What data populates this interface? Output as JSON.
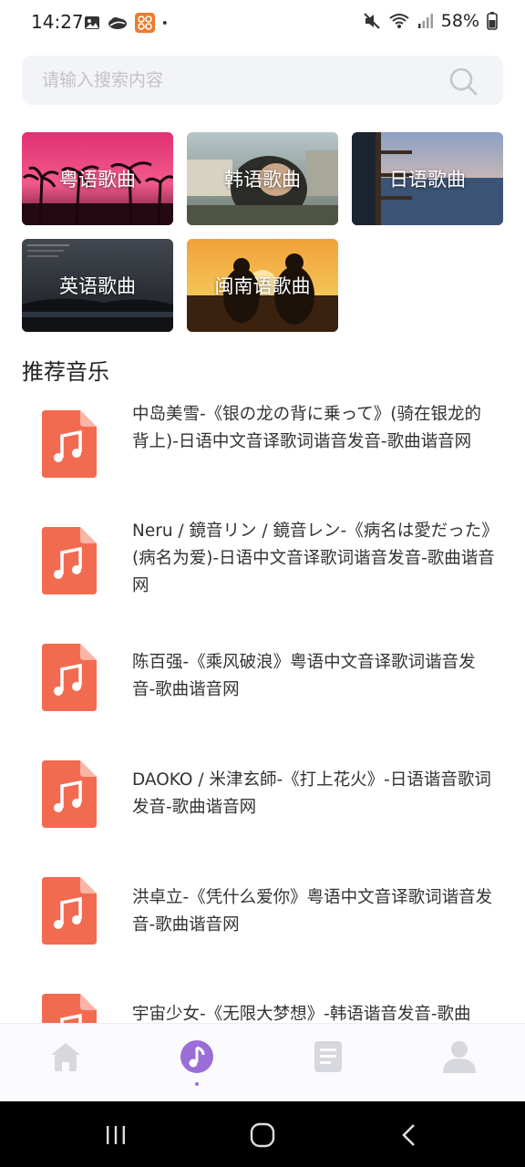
{
  "status_bar": {
    "time": "14:27",
    "battery": "58%",
    "left_icons": [
      "gallery-icon",
      "cloud-icon",
      "app-icon",
      "dot-icon"
    ],
    "right_icons": [
      "mute-icon",
      "wifi-icon",
      "signal-icon",
      "battery-icon"
    ]
  },
  "search": {
    "placeholder": "请输入搜索内容",
    "value": ""
  },
  "categories": [
    {
      "label": "粤语歌曲"
    },
    {
      "label": "韩语歌曲"
    },
    {
      "label": "日语歌曲"
    },
    {
      "label": "英语歌曲"
    },
    {
      "label": "闽南语歌曲"
    }
  ],
  "section": {
    "title": "推荐音乐"
  },
  "songs": [
    {
      "title": "中岛美雪-《银の龙の背に乗って》(骑在银龙的背上)-日语中文音译歌词谐音发音-歌曲谐音网"
    },
    {
      "title": "Neru / 鏡音リン / 鏡音レン-《病名は愛だった》(病名为爱)-日语中文音译歌词谐音发音-歌曲谐音网"
    },
    {
      "title": "陈百强-《乘风破浪》粤语中文音译歌词谐音发音-歌曲谐音网"
    },
    {
      "title": "DAOKO / 米津玄師-《打上花火》-日语谐音歌词发音-歌曲谐音网"
    },
    {
      "title": "洪卓立-《凭什么爱你》粤语中文音译歌词谐音发音-歌曲谐音网"
    },
    {
      "title": "宇宙少女-《无限大梦想》-韩语谐音发音-歌曲"
    }
  ],
  "bottom_nav": {
    "items": [
      "home-icon",
      "music-icon",
      "document-icon",
      "user-icon"
    ],
    "active": "music-icon",
    "accent_color": "#9a6dd7",
    "inactive_color": "#d6d8de"
  },
  "colors": {
    "song_icon": "#f26b50"
  }
}
